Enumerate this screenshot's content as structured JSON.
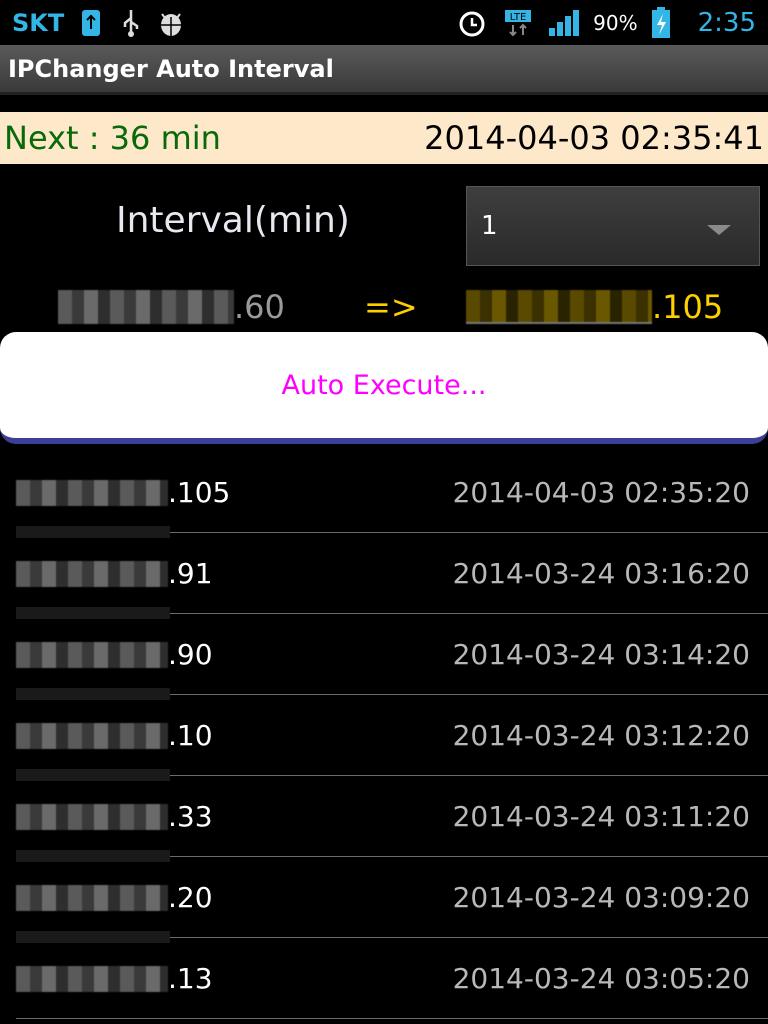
{
  "statusbar": {
    "carrier": "SKT",
    "battery_pct": "90%",
    "clock": "2:35",
    "network": "LTE",
    "icons": [
      "usb-debug-icon",
      "usb-icon",
      "android-debug-icon",
      "alarm-icon",
      "lte-icon",
      "signal-icon",
      "battery-charging-icon"
    ]
  },
  "titlebar": {
    "title": "IPChanger Auto Interval"
  },
  "nextbar": {
    "next": "Next : 36 min",
    "now": "2014-04-03 02:35:41"
  },
  "interval": {
    "label": "Interval(min)",
    "selected": "1"
  },
  "ip_change": {
    "old_suffix": ".60",
    "arrow": "=>",
    "new_suffix": ".105"
  },
  "execute": {
    "label": "Auto Execute..."
  },
  "history": [
    {
      "ip_suffix": ".105",
      "time": "2014-04-03 02:35:20"
    },
    {
      "ip_suffix": ".91",
      "time": "2014-03-24 03:16:20"
    },
    {
      "ip_suffix": ".90",
      "time": "2014-03-24 03:14:20"
    },
    {
      "ip_suffix": ".10",
      "time": "2014-03-24 03:12:20"
    },
    {
      "ip_suffix": ".33",
      "time": "2014-03-24 03:11:20"
    },
    {
      "ip_suffix": ".20",
      "time": "2014-03-24 03:09:20"
    },
    {
      "ip_suffix": ".13",
      "time": "2014-03-24 03:05:20"
    }
  ],
  "colors": {
    "accent": "#33b5e5",
    "next_text": "#0a6a0a",
    "ip_new": "#ffd000",
    "execute_text": "#ff00ff"
  }
}
